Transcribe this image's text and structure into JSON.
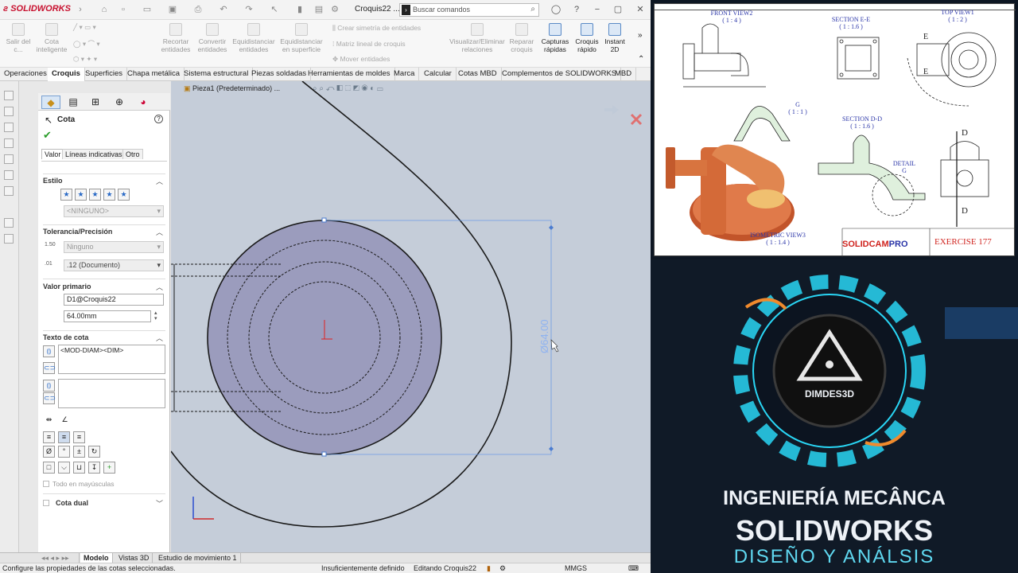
{
  "app": {
    "name": "SOLIDWORKS",
    "document_title": "Croquis22 ...",
    "search_placeholder": "Buscar comandos"
  },
  "ribbon": {
    "buttons": [
      {
        "label": "Salir del c...",
        "enabled": false
      },
      {
        "label": "Cota inteligente",
        "enabled": false
      },
      {
        "label": "Recortar entidades",
        "enabled": false
      },
      {
        "label": "Convertir entidades",
        "enabled": false
      },
      {
        "label": "Equidistanciar entidades",
        "enabled": false
      },
      {
        "label": "Equidistanciar en superficie",
        "enabled": false
      },
      {
        "label": "Visualizar/Eliminar relaciones",
        "enabled": false
      },
      {
        "label": "Reparar croquis",
        "enabled": false
      },
      {
        "label": "Capturas rápidas",
        "enabled": true
      },
      {
        "label": "Croquis rápido",
        "enabled": true
      },
      {
        "label": "Instant 2D",
        "enabled": true
      }
    ],
    "small_commands": [
      "Crear simetría de entidades",
      "Matriz lineal de croquis",
      "Mover entidades"
    ]
  },
  "tabs": [
    "Operaciones",
    "Croquis",
    "Superficies",
    "Chapa metálica",
    "Sistema estructural",
    "Piezas soldadas",
    "Herramientas de moldes",
    "Marca",
    "Calcular",
    "Cotas MBD",
    "Complementos de SOLIDWORKS",
    "MBD"
  ],
  "active_tab": "Croquis",
  "feature_tree": {
    "breadcrumb": "Pieza1 (Predeterminado) ..."
  },
  "property_manager": {
    "title": "Cota",
    "subtabs": [
      "Valor",
      "Líneas indicativas",
      "Otro"
    ],
    "estilo": {
      "header": "Estilo",
      "value": "<NINGUNO>"
    },
    "tolerancia": {
      "header": "Tolerancia/Precisión",
      "tolerance": "Ninguno",
      "precision": ".12 (Documento)",
      "tol_icon_label": "1.50",
      "prec_icon_label": ".01"
    },
    "valor_primario": {
      "header": "Valor primario",
      "name": "D1@Croquis22",
      "value": "64.00mm"
    },
    "texto_cota": {
      "header": "Texto de cota",
      "text": "<MOD-DIAM><DIM>"
    },
    "symbols": [
      "Ø",
      "°",
      "±",
      "↻"
    ],
    "todo_mayusculas": "Todo en mayúsculas",
    "cota_dual": "Cota dual"
  },
  "viewport": {
    "dimension_label": "Ø64.00"
  },
  "bottom_tabs": [
    "Modelo",
    "Vistas 3D",
    "Estudio de movimiento 1"
  ],
  "active_bottom_tab": "Modelo",
  "status": {
    "message": "Configure las propiedades de las cotas seleccionadas.",
    "definition": "Insuficientemente definido",
    "editing": "Editando Croquis22",
    "units": "MMGS"
  },
  "thumbnail": {
    "views": {
      "front": [
        "FRONT VIEW2",
        "( 1 : 4 )"
      ],
      "section_ee": [
        "SECTION E-E",
        "( 1 : 1.6 )"
      ],
      "top": [
        "TOP VIEW1",
        "( 1 : 2 )"
      ],
      "detail_g": [
        "G",
        "( 1 : 1 )"
      ],
      "section_dd": [
        "SECTION D-D",
        "( 1 : 1.6 )"
      ],
      "detail_label": [
        "DETAIL",
        "G"
      ],
      "isometric": [
        "ISOMETRIC VIEW3",
        "( 1 : 1.4 )"
      ]
    },
    "section_letters": [
      "E",
      "E",
      "D",
      "D"
    ],
    "title_block": {
      "company_a": "SOLIDCAM",
      "company_b": "PRO",
      "exercise": "EXERCISE 177"
    },
    "logo_text": "DIMDES3D",
    "course_line1": "INGENIERÍA MECÂNCA",
    "course_line2": "SOLIDWORKS",
    "course_line3": "DISEÑO Y ANÁLSIS",
    "colors": {
      "accent_cyan": "#29d6f5",
      "title_red": "#d0241f",
      "view_label_blue": "#2a35a8"
    }
  }
}
